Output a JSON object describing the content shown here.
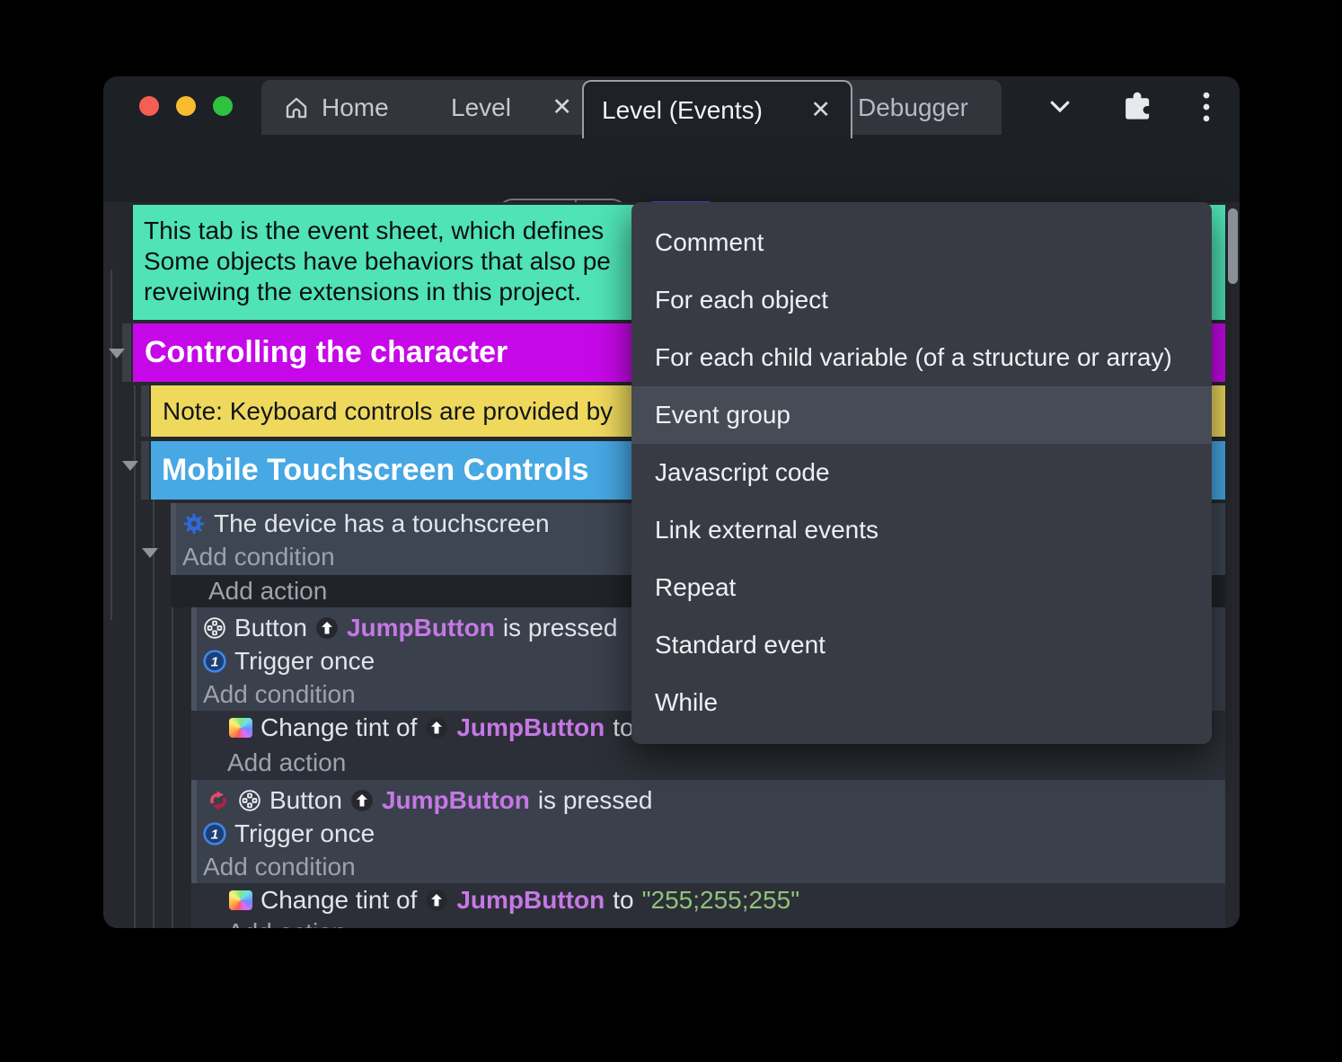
{
  "colors": {
    "accent_purple": "#5b3ed6",
    "comment_teal": "#4fe3b6",
    "group_magenta": "#c608e8",
    "note_yellow": "#efd95d",
    "group_blue": "#47a8e3",
    "selected_row": "#3e4553",
    "object_violet": "#c678e6",
    "string_green": "#8ec37a",
    "traffic_red": "#f55e52",
    "traffic_yellow": "#f7bd2e",
    "traffic_green": "#2ec23e"
  },
  "tabs": {
    "home": "Home",
    "level": "Level",
    "level_events": "Level (Events)",
    "debugger": "Debugger",
    "close_glyph": "✕"
  },
  "toolbar": {
    "icons": [
      "sidebar-layout",
      "save",
      "play",
      "play-dropdown",
      "preview-globe",
      "add-event",
      "add-subevent",
      "add-comment",
      "add-circle",
      "trash",
      "undo",
      "redo",
      "search"
    ]
  },
  "menu": {
    "highlighted_item": "Event group",
    "items": [
      "Comment",
      "For each object",
      "For each child variable (of a structure or array)",
      "Event group",
      "Javascript code",
      "Link external events",
      "Repeat",
      "Standard event",
      "While"
    ]
  },
  "sheet": {
    "comment_line1": "This tab is the event sheet, which defines",
    "comment_line2": "Some objects have behaviors that also pe",
    "comment_line3": "reveiwing the extensions in this project.",
    "group_controlling": "Controlling the character",
    "note_keyboard": "Note: Keyboard controls are provided by",
    "group_mobile": "Mobile Touchscreen Controls",
    "cond_touchscreen": "The device has a touchscreen",
    "add_condition": "Add condition",
    "add_action": "Add action",
    "btn_prefix": "Button",
    "obj_name": "JumpButton",
    "is_pressed": "is pressed",
    "trigger_once": "Trigger once",
    "change_tint": "Change tint of",
    "to_word": "to",
    "tint_value": "\"255;255;255\""
  }
}
